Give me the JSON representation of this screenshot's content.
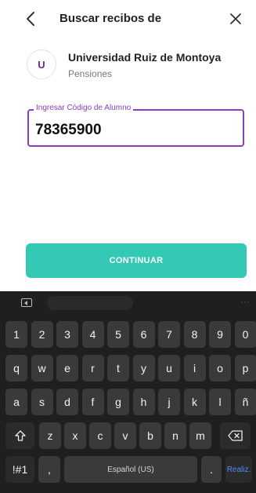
{
  "header": {
    "title": "Buscar recibos de",
    "back_icon": "chevron-left-icon",
    "close_icon": "close-icon"
  },
  "merchant": {
    "initial": "U",
    "name": "Universidad Ruiz de Montoya",
    "subtitle": "Pensiones"
  },
  "field": {
    "label": "Ingresar Código de Alumno",
    "value": "78365900"
  },
  "cta": {
    "label": "CONTINUAR",
    "color": "#33c9b4"
  },
  "colors": {
    "accent": "#8a3fb8",
    "keyboard_bg": "#1f1f21",
    "key": "#3a3a3c"
  },
  "keyboard": {
    "row1": [
      "1",
      "2",
      "3",
      "4",
      "5",
      "6",
      "7",
      "8",
      "9",
      "0"
    ],
    "row2": [
      "q",
      "w",
      "e",
      "r",
      "t",
      "y",
      "u",
      "i",
      "o",
      "p"
    ],
    "row3": [
      "a",
      "s",
      "d",
      "f",
      "g",
      "h",
      "j",
      "k",
      "l",
      "ñ"
    ],
    "row4": [
      "z",
      "x",
      "c",
      "v",
      "b",
      "n",
      "m"
    ],
    "symbols": "!#1",
    "comma": ",",
    "space": "Español (US)",
    "period": ".",
    "action": "Realiz.",
    "shift_icon": "shift-icon",
    "backspace_icon": "backspace-icon",
    "toolbar_icon": "keyboard-toolbar-icon"
  }
}
